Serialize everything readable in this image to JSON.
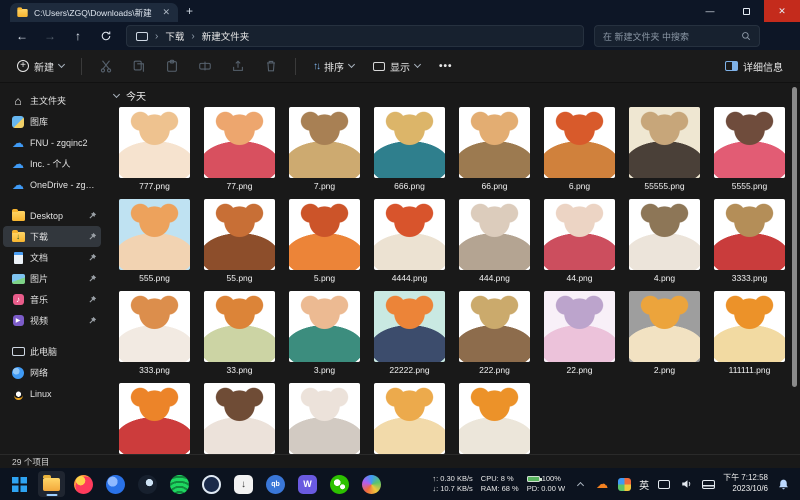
{
  "window": {
    "tab_title": "C:\\Users\\ZGQ\\Downloads\\新建",
    "controls": {
      "minimize": "—",
      "close_glyph": "✕"
    }
  },
  "address": {
    "breadcrumbs": [
      "下载",
      "新建文件夹"
    ],
    "search_placeholder": "在 新建文件夹 中搜索"
  },
  "toolbar": {
    "new_label": "新建",
    "sort_label": "排序",
    "view_label": "显示",
    "details_label": "详细信息"
  },
  "sidebar": {
    "items": [
      {
        "id": "home",
        "label": "主文件夹",
        "icon": "home-icon"
      },
      {
        "id": "gallery",
        "label": "图库",
        "icon": "gallery-icon"
      },
      {
        "id": "fnu",
        "label": "FNU - zgqinc2",
        "icon": "cloud-icon"
      },
      {
        "id": "inc",
        "label": "Inc. - 个人",
        "icon": "cloud-icon"
      },
      {
        "id": "onedrive",
        "label": "OneDrive - zgqinc",
        "icon": "cloud-icon"
      },
      {
        "divider": true
      },
      {
        "id": "desktop",
        "label": "Desktop",
        "icon": "folder-icon",
        "pinned": true
      },
      {
        "id": "downloads",
        "label": "下载",
        "icon": "download-icon",
        "pinned": true,
        "selected": true
      },
      {
        "id": "documents",
        "label": "文档",
        "icon": "document-icon",
        "pinned": true
      },
      {
        "id": "pictures",
        "label": "图片",
        "icon": "pictures-icon",
        "pinned": true
      },
      {
        "id": "music",
        "label": "音乐",
        "icon": "music-icon",
        "pinned": true
      },
      {
        "id": "videos",
        "label": "视频",
        "icon": "videos-icon",
        "pinned": true
      },
      {
        "divider": true
      },
      {
        "id": "thispc",
        "label": "此电脑",
        "icon": "computer-icon"
      },
      {
        "id": "network",
        "label": "网络",
        "icon": "network-icon"
      },
      {
        "id": "linux",
        "label": "Linux",
        "icon": "linux-icon"
      }
    ]
  },
  "main": {
    "group_label": "今天",
    "files": [
      {
        "name": "777.png",
        "bg": "#ffffff",
        "c1": "#eec28f",
        "c2": "#f6e3cf"
      },
      {
        "name": "77.png",
        "bg": "#ffffff",
        "c1": "#eda66e",
        "c2": "#d8505f"
      },
      {
        "name": "7.png",
        "bg": "#ffffff",
        "c1": "#a88054",
        "c2": "#cdaa70"
      },
      {
        "name": "666.png",
        "bg": "#ffffff",
        "c1": "#dcb569",
        "c2": "#2f7f8d"
      },
      {
        "name": "66.png",
        "bg": "#ffffff",
        "c1": "#e3ad72",
        "c2": "#9c7a50"
      },
      {
        "name": "6.png",
        "bg": "#ffffff",
        "c1": "#d85a2b",
        "c2": "#d0813c"
      },
      {
        "name": "55555.png",
        "bg": "#efe7d2",
        "c1": "#c7a67a",
        "c2": "#4a4038"
      },
      {
        "name": "5555.png",
        "bg": "#ffffff",
        "c1": "#6f4c3c",
        "c2": "#e25c74"
      },
      {
        "name": "555.png",
        "bg": "#bfe2f2",
        "c1": "#eda25c",
        "c2": "#f2d3b2"
      },
      {
        "name": "55.png",
        "bg": "#ffffff",
        "c1": "#c86f36",
        "c2": "#8d4e2b"
      },
      {
        "name": "5.png",
        "bg": "#ffffff",
        "c1": "#cc5429",
        "c2": "#ec8438"
      },
      {
        "name": "4444.png",
        "bg": "#ffffff",
        "c1": "#d8542c",
        "c2": "#ece2d2"
      },
      {
        "name": "444.png",
        "bg": "#ffffff",
        "c1": "#dcccbc",
        "c2": "#b4a492"
      },
      {
        "name": "44.png",
        "bg": "#ffffff",
        "c1": "#ecd4c4",
        "c2": "#cc4e5e"
      },
      {
        "name": "4.png",
        "bg": "#ffffff",
        "c1": "#8d7657",
        "c2": "#ece4da"
      },
      {
        "name": "3333.png",
        "bg": "#ffffff",
        "c1": "#b48e58",
        "c2": "#c93c3c"
      },
      {
        "name": "333.png",
        "bg": "#ffffff",
        "c1": "#dc8e4c",
        "c2": "#f2eae2"
      },
      {
        "name": "33.png",
        "bg": "#ffffff",
        "c1": "#dc8438",
        "c2": "#ccd4a4"
      },
      {
        "name": "3.png",
        "bg": "#ffffff",
        "c1": "#ecba92",
        "c2": "#3c8d7e"
      },
      {
        "name": "22222.png",
        "bg": "#c9e9e2",
        "c1": "#ec8438",
        "c2": "#3c4c6c"
      },
      {
        "name": "222.png",
        "bg": "#ffffff",
        "c1": "#cbaa6c",
        "c2": "#8d6c4c"
      },
      {
        "name": "22.png",
        "bg": "#f8f0f8",
        "c1": "#bca4cc",
        "c2": "#ecc2da"
      },
      {
        "name": "2.png",
        "bg": "#9e9e9e",
        "c1": "#eca43c",
        "c2": "#f2e2c2"
      },
      {
        "name": "111111.png",
        "bg": "#ffffff",
        "c1": "#ec9229",
        "c2": "#f2daa2"
      },
      {
        "name": "",
        "bg": "#ffffff",
        "c1": "#ec8429",
        "c2": "#cc3c3c"
      },
      {
        "name": "",
        "bg": "#ffffff",
        "c1": "#6f4c36",
        "c2": "#ece2da"
      },
      {
        "name": "",
        "bg": "#ffffff",
        "c1": "#ece2da",
        "c2": "#d2cac2"
      },
      {
        "name": "",
        "bg": "#ffffff",
        "c1": "#ecaa4c",
        "c2": "#f2daaa"
      },
      {
        "name": "",
        "bg": "#ffffff",
        "c1": "#ec9229",
        "c2": "#ece6da"
      }
    ]
  },
  "statusbar": {
    "items_count": "29 个项目"
  },
  "taskbar": {
    "apps": [
      {
        "id": "start"
      },
      {
        "id": "file-explorer",
        "active": true
      },
      {
        "id": "firefox"
      },
      {
        "id": "files-app"
      },
      {
        "id": "steam"
      },
      {
        "id": "spotify"
      },
      {
        "id": "browser-app"
      },
      {
        "id": "installer-app"
      },
      {
        "id": "qbittorrent",
        "glyph": "qb"
      },
      {
        "id": "wallpaper-app",
        "glyph": "W"
      },
      {
        "id": "wechat"
      },
      {
        "id": "sphere-app"
      }
    ],
    "tray": {
      "net_up": "↑: 0.30 KB/s",
      "net_down": "↓: 10.7 KB/s",
      "cpu": "CPU: 8 %",
      "battery": "100%",
      "ram": "RAM: 68 %",
      "power": "PD: 0.00 W",
      "ime": "英",
      "time": "下午 7:12:58",
      "date": "2023/10/6"
    },
    "accent": "#9ecfff"
  }
}
